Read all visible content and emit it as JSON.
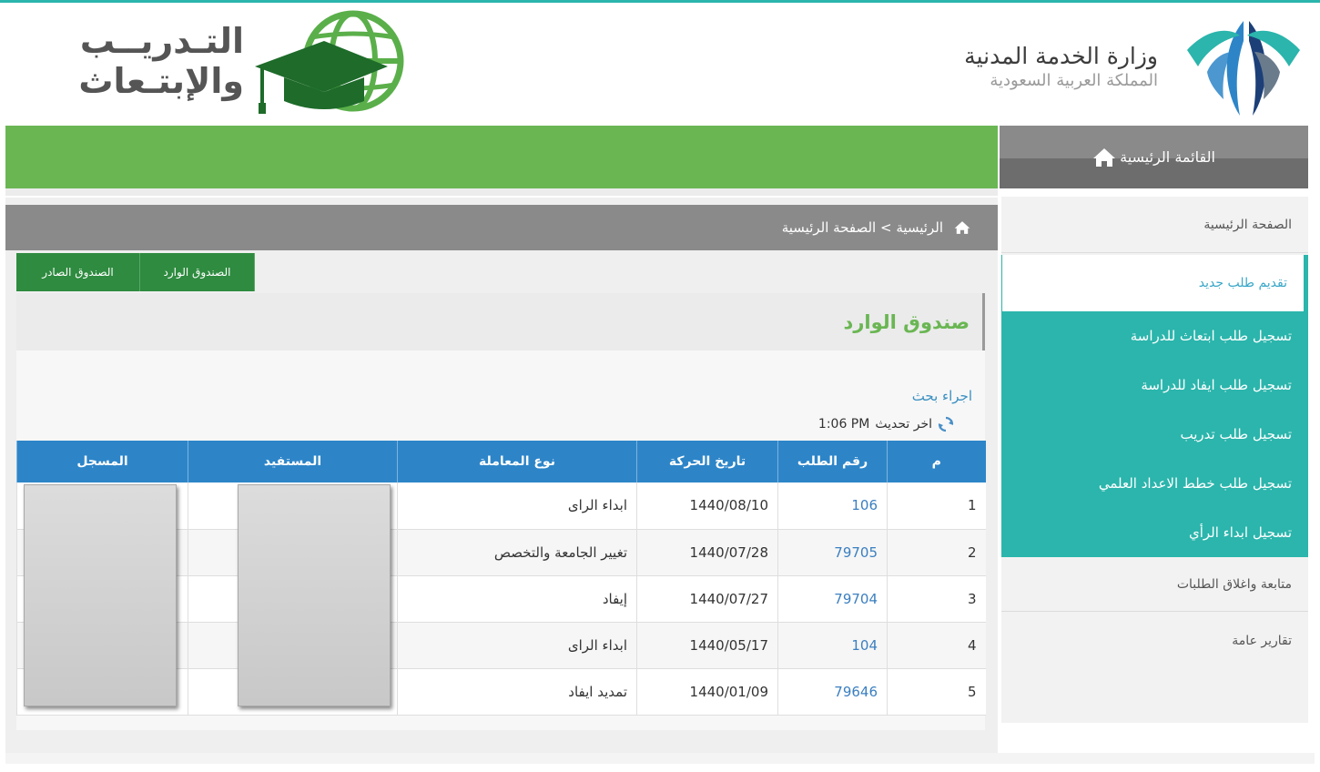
{
  "header": {
    "ministry_name": "وزارة الخدمة المدنية",
    "ministry_sub": "المملكة العربية السعودية",
    "training_line1": "التـدريــب",
    "training_line2": "والإبتـعاث"
  },
  "nav": {
    "main_menu_label": "القائمة الرئيسية"
  },
  "sidebar": {
    "items": [
      {
        "label": "الصفحة الرئيسية"
      },
      {
        "label": "تقديم طلب جديد"
      },
      {
        "label": "تسجيل طلب ابتعاث للدراسة"
      },
      {
        "label": "تسجيل طلب ايفاد للدراسة"
      },
      {
        "label": "تسجيل طلب تدريب"
      },
      {
        "label": "تسجيل طلب خطط الاعداد العلمي"
      },
      {
        "label": "تسجيل ابداء الرأي"
      },
      {
        "label": "متابعة واغلاق الطلبات"
      },
      {
        "label": "تقارير عامة"
      }
    ]
  },
  "breadcrumb": {
    "text": "الرئيسية > الصفحة الرئيسية"
  },
  "tabs": {
    "inbox": "الصندوق الوارد",
    "outbox": "الصندوق الصادر"
  },
  "panel": {
    "title": "صندوق الوارد",
    "search_link": "اجراء بحث",
    "last_update_label": "اخر تحديث",
    "last_update_time": "1:06 PM"
  },
  "table": {
    "headers": [
      "م",
      "رقم الطلب",
      "تاريخ الحركة",
      "نوع المعاملة",
      "المستفيد",
      "المسجل"
    ],
    "rows": [
      {
        "n": "1",
        "req": "106",
        "date": "1440/08/10",
        "type": "ابداء الراى"
      },
      {
        "n": "2",
        "req": "79705",
        "date": "1440/07/28",
        "type": "تغيير الجامعة والتخصص"
      },
      {
        "n": "3",
        "req": "79704",
        "date": "1440/07/27",
        "type": "إيفاد"
      },
      {
        "n": "4",
        "req": "104",
        "date": "1440/05/17",
        "type": "ابداء الراى"
      },
      {
        "n": "5",
        "req": "79646",
        "date": "1440/01/09",
        "type": "تمديد ايفاد"
      }
    ]
  },
  "colors": {
    "teal": "#2bb5ac",
    "green": "#6ab653",
    "dark_green": "#2e8b3f",
    "blue_header": "#2d85c8",
    "link_blue": "#3a7fc0"
  },
  "icons": {
    "home": "home-icon",
    "refresh": "refresh-icon",
    "globe_cap": "graduation-globe-icon",
    "ministry_logo": "ministry-logo-icon"
  }
}
